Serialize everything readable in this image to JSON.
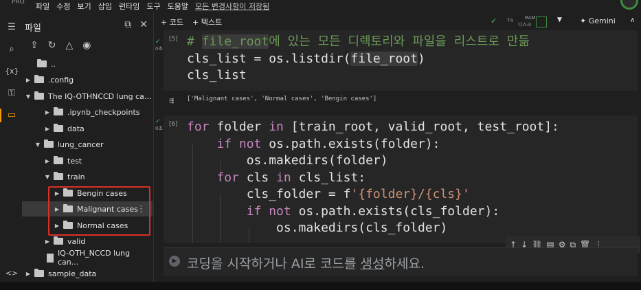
{
  "menubar": {
    "pro": "PRO",
    "items": [
      "파일",
      "수정",
      "보기",
      "삽입",
      "런타임",
      "도구",
      "도움말"
    ],
    "saved": "모든 변경사항이 저장됨"
  },
  "toolbar": {
    "add_code": "+ 코드",
    "add_text": "+ 텍스트",
    "runtime": "T4",
    "ram_label": "RAM",
    "disk_label": "디스크",
    "gemini": "Gemini"
  },
  "filepanel": {
    "title": "파일",
    "tree": [
      {
        "label": "..",
        "type": "up",
        "indent": 0
      },
      {
        "label": ".config",
        "type": "folder",
        "arrow": "right",
        "indent": 0
      },
      {
        "label": "The IQ-OTHNCCD lung ca...",
        "type": "folder",
        "arrow": "down",
        "indent": 0
      },
      {
        "label": ".ipynb_checkpoints",
        "type": "folder",
        "arrow": "right",
        "indent": 1
      },
      {
        "label": "data",
        "type": "folder",
        "arrow": "right",
        "indent": 1
      },
      {
        "label": "lung_cancer",
        "type": "folder",
        "arrow": "down",
        "indent": 1
      },
      {
        "label": "test",
        "type": "folder",
        "arrow": "right",
        "indent": 2
      },
      {
        "label": "train",
        "type": "folder",
        "arrow": "down",
        "indent": 2
      },
      {
        "label": "Bengin cases",
        "type": "folder",
        "arrow": "right",
        "indent": 3
      },
      {
        "label": "Malignant cases",
        "type": "folder",
        "arrow": "right",
        "indent": 3,
        "highlight": true
      },
      {
        "label": "Normal cases",
        "type": "folder",
        "arrow": "right",
        "indent": 3
      },
      {
        "label": "valid",
        "type": "folder",
        "arrow": "right",
        "indent": 2
      },
      {
        "label": "IQ-OTH_NCCD lung can...",
        "type": "file",
        "indent": 1
      },
      {
        "label": "sample_data",
        "type": "folder",
        "arrow": "right",
        "indent": 0
      }
    ]
  },
  "cell5": {
    "number": "[5]",
    "output": "['Malignant cases', 'Normal cases', 'Bengin cases']"
  },
  "cell6": {
    "number": "[6]"
  },
  "newcell": {
    "placeholder_a": "코딩을 시작하거나 AI로 코드를 ",
    "placeholder_gen": "생성",
    "placeholder_b": "하세요."
  },
  "colors": {
    "accent": "#f29900",
    "red_box": "#d93025",
    "keyword": "#c586c0",
    "comment": "#6a9955"
  }
}
